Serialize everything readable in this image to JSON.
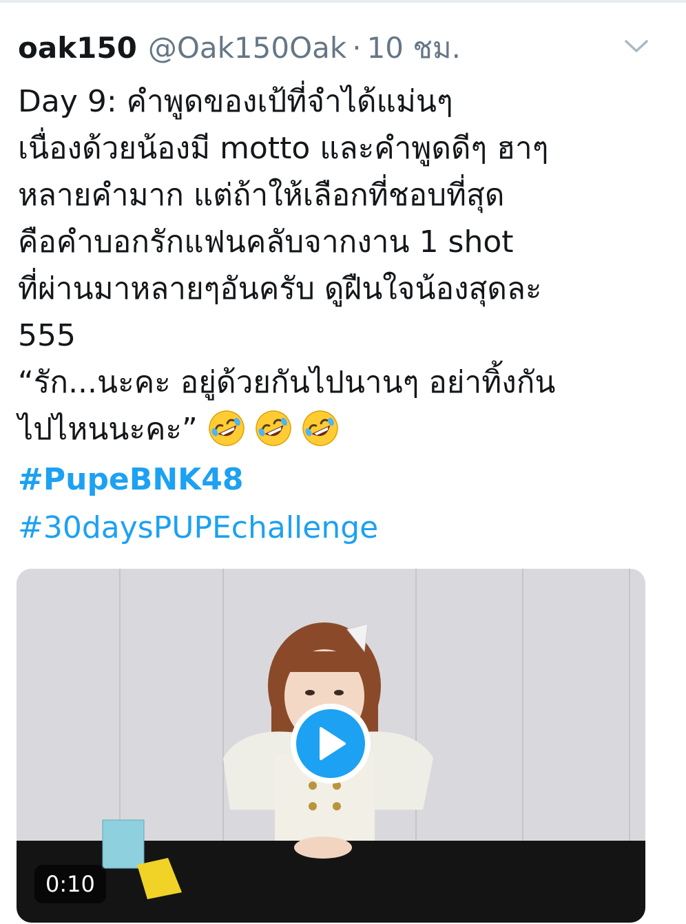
{
  "tweet": {
    "display_name": "oak150",
    "handle": "@Oak150Oak",
    "separator": "·",
    "timestamp": "10 ชม.",
    "text_lines": [
      "Day 9: คำพูดของเป้ที่จำได้แม่นๆ",
      "เนื่องด้วยน้องมี motto และคำพูดดีๆ ฮาๆ",
      "หลายคำมาก แต่ถ้าให้เลือกที่ชอบที่สุด",
      "คือคำบอกรักแฟนคลับจากงาน 1 shot",
      "ที่ผ่านมาหลายๆอันครับ ดูฝืนใจน้องสุดละ",
      "555",
      "“รัก...นะคะ อยู่ด้วยกันไปนานๆ อย่าทิ้งกัน",
      "ไปไหนนะคะ”"
    ],
    "emojis": [
      "rofl-emoji",
      "rofl-emoji",
      "rofl-emoji"
    ],
    "hashtags": [
      "#PupeBNK48",
      "#30daysPUPEchallenge"
    ]
  },
  "media": {
    "type": "video",
    "duration": "0:10",
    "play_icon": "play-icon"
  },
  "icons": {
    "caret": "chevron-down-icon"
  },
  "colors": {
    "link": "#1da1f2",
    "secondary_text": "#657786",
    "primary_text": "#14171a"
  }
}
